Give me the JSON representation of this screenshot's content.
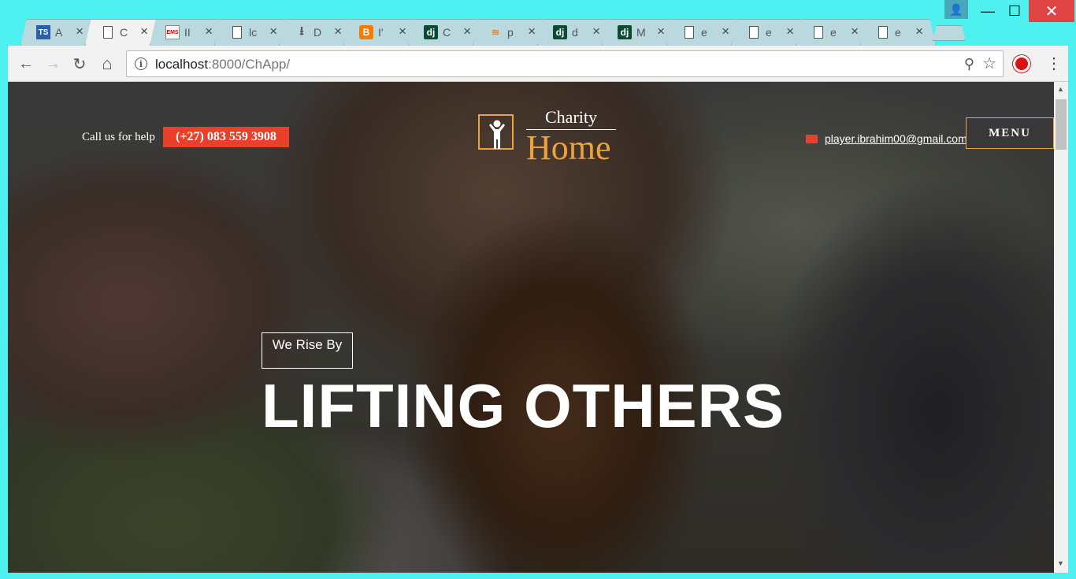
{
  "browser": {
    "tabs": [
      {
        "title": "A",
        "icon": "ts-icon",
        "glyph": "TS",
        "active": false
      },
      {
        "title": "C",
        "icon": "document-icon",
        "glyph": "",
        "active": true
      },
      {
        "title": "II",
        "icon": "ems-icon",
        "glyph": "EMS",
        "active": false
      },
      {
        "title": "lc",
        "icon": "document-icon",
        "glyph": "",
        "active": false
      },
      {
        "title": "D",
        "icon": "download-icon",
        "glyph": "⭳",
        "active": false
      },
      {
        "title": "I'",
        "icon": "blogger-icon",
        "glyph": "B",
        "active": false
      },
      {
        "title": "C",
        "icon": "django-icon",
        "glyph": "dj",
        "active": false
      },
      {
        "title": "p",
        "icon": "stackoverflow-icon",
        "glyph": "≋",
        "active": false
      },
      {
        "title": "d",
        "icon": "django-icon",
        "glyph": "dj",
        "active": false
      },
      {
        "title": "M",
        "icon": "django-icon",
        "glyph": "dj",
        "active": false
      },
      {
        "title": "e",
        "icon": "document-icon",
        "glyph": "",
        "active": false
      },
      {
        "title": "e",
        "icon": "document-icon",
        "glyph": "",
        "active": false
      },
      {
        "title": "e",
        "icon": "document-icon",
        "glyph": "",
        "active": false
      },
      {
        "title": "e",
        "icon": "document-icon",
        "glyph": "",
        "active": false
      }
    ],
    "close_glyph": "×",
    "url_host": "localhost",
    "url_path": ":8000/ChApp/",
    "nav": {
      "back": "←",
      "forward": "→",
      "reload": "↻",
      "home": "⌂"
    },
    "window": {
      "user": "👤",
      "minimize": "—",
      "maximize": "☐",
      "close": "✕"
    },
    "toolbar_icons": {
      "info": "i",
      "zoom": "⚲",
      "star": "☆",
      "menu": "⋮"
    },
    "scroll": {
      "up": "▲",
      "down": "▼"
    }
  },
  "page": {
    "call_label": "Call us for help",
    "phone": "(+27) 083 559 3908",
    "brand_top": "Charity",
    "brand_main": "Home",
    "email": "player.ibrahim00@gmail.com",
    "menu_label": "MENU",
    "tagline": "We Rise By",
    "headline": "LIFTING OTHERS"
  },
  "colors": {
    "accent_orange": "#f0a23a",
    "phone_red": "#e8402a",
    "window_frame": "#4ff0f0"
  }
}
